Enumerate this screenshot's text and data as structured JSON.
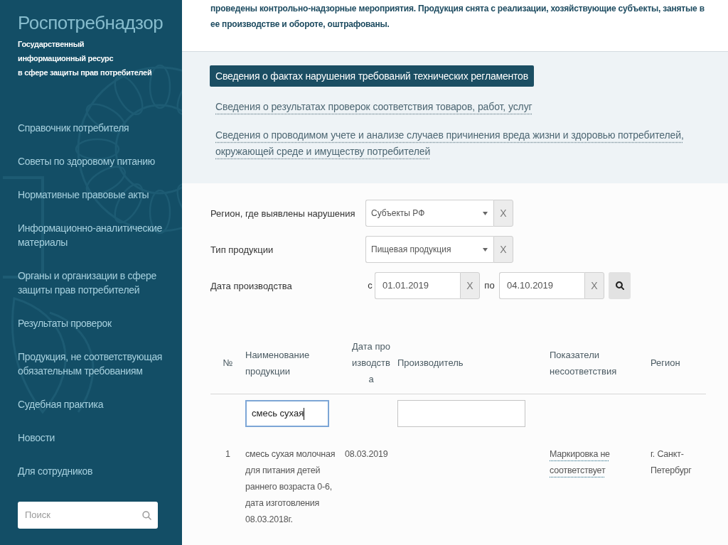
{
  "sidebar": {
    "title": "Роспотребнадзор",
    "subtitle": "Государственный\nинформационный ресурс\nв сфере защиты прав потребителей",
    "nav": [
      {
        "label": "Справочник потребителя"
      },
      {
        "label": "Советы по здоровому питанию"
      },
      {
        "label": "Нормативные правовые акты"
      },
      {
        "label": "Информационно-аналитические материалы"
      },
      {
        "label": "Органы и организации в сфере защиты прав потребителей"
      },
      {
        "label": "Результаты проверок"
      },
      {
        "label": "Продукция, не соответствующая обязательным требованиям"
      },
      {
        "label": "Судебная практика"
      },
      {
        "label": "Новости"
      },
      {
        "label": "Для сотрудников"
      }
    ],
    "search": {
      "placeholder": "Поиск"
    }
  },
  "intro": "проведены контрольно-надзорные мероприятия. Продукция снята с реализации, хозяйствующие субъекты, занятые в ее производстве и обороте, оштрафованы.",
  "tabs": [
    {
      "label": "Сведения о фактах нарушения требований технических регламентов",
      "selected": true
    },
    {
      "label": "Сведения о результатах проверок соответствия товаров, работ, услуг",
      "selected": false
    },
    {
      "label": "Сведения о проводимом учете и анализе случаев причинения вреда жизни и здоровью потребителей, окружающей среде и имуществу потребителей",
      "selected": false
    }
  ],
  "filters": [
    {
      "kind": "select",
      "label": "Регион, где выявлены нарушения",
      "value": "Субъекты РФ",
      "clear": "X"
    },
    {
      "kind": "select",
      "label": "Тип продукции",
      "value": "Пищевая продукция",
      "clear": "X"
    },
    {
      "kind": "date_range",
      "label": "Дата производства",
      "from": {
        "prefix": "с",
        "value": "01.01.2019",
        "clear": "X"
      },
      "to": {
        "prefix": "по",
        "value": "04.10.2019",
        "clear": "X"
      }
    }
  ],
  "table": {
    "columns": [
      {
        "label": "№"
      },
      {
        "label": "Наименование продукции",
        "filter": {
          "value": "смесь сухая",
          "focused": true
        }
      },
      {
        "label": "Дата производства"
      },
      {
        "label": "Производитель",
        "filter": {
          "focused": false
        }
      },
      {
        "label": "Показатели несоответствия"
      },
      {
        "label": "Регион"
      }
    ],
    "rows": [
      {
        "cells": [
          {
            "kind": "text",
            "text": "1"
          },
          {
            "kind": "text",
            "text": "смесь сухая молочная для питания детей раннего возраста 0-6, дата изготовления 08.03.2018г."
          },
          {
            "kind": "text",
            "text": "08.03.2019"
          },
          {
            "kind": "empty"
          },
          {
            "kind": "link",
            "text": "Маркировка не соответствует"
          },
          {
            "kind": "text",
            "text": "г. Санкт-Петербург"
          }
        ]
      }
    ]
  }
}
